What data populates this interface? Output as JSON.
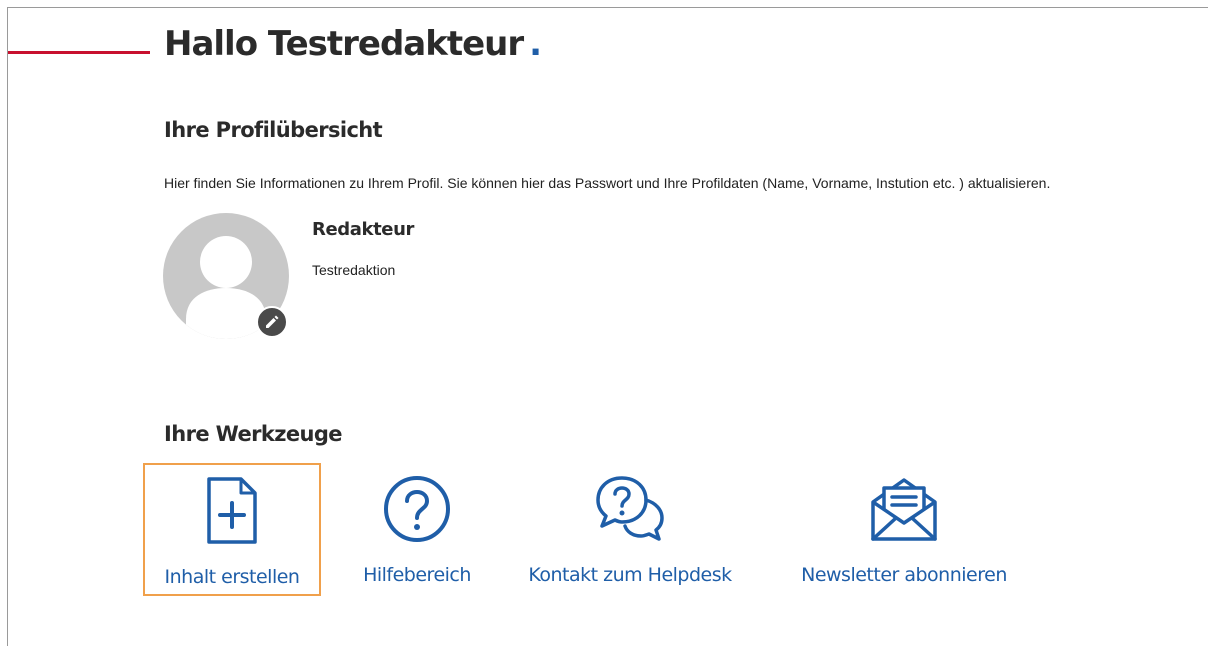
{
  "header": {
    "greeting": "Hallo Testredakteur",
    "greeting_dot": ".",
    "accent_red": "#c8102e",
    "accent_blue": "#1f5ea8"
  },
  "profile": {
    "section_title": "Ihre Profilübersicht",
    "description": "Hier finden Sie Informationen zu Ihrem Profil. Sie können hier das Passwort und Ihre Profildaten (Name, Vorname, Instution etc. ) aktualisieren.",
    "name": "Redakteur",
    "organization": "Testredaktion",
    "avatar_icon": "user-placeholder-icon",
    "edit_icon": "pencil-icon"
  },
  "tools": {
    "section_title": "Ihre Werkzeuge",
    "items": [
      {
        "label": "Inhalt erstellen",
        "icon": "document-plus-icon",
        "selected": true
      },
      {
        "label": "Hilfebereich",
        "icon": "question-circle-icon",
        "selected": false
      },
      {
        "label": "Kontakt zum Helpdesk",
        "icon": "chat-question-icon",
        "selected": false
      },
      {
        "label": "Newsletter abonnieren",
        "icon": "envelope-open-icon",
        "selected": false
      }
    ],
    "selected_border_color": "#f0a04b"
  }
}
